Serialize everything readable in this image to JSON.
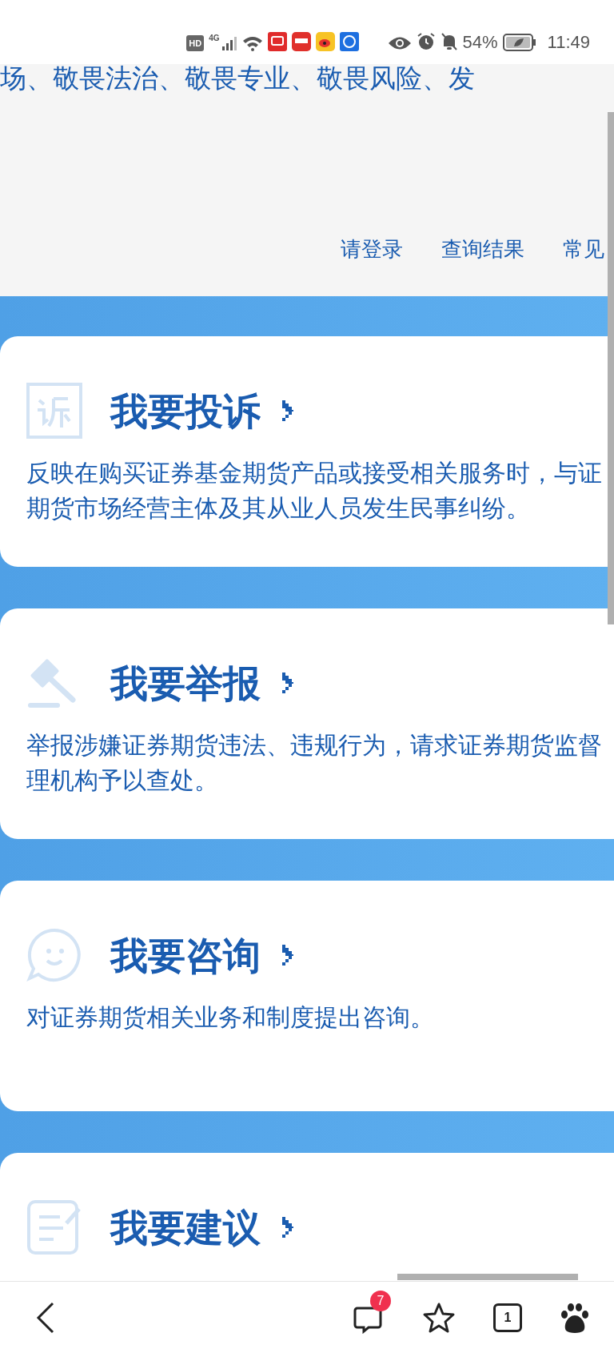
{
  "status_bar": {
    "hd": "HD",
    "network": "4G",
    "battery": "54%",
    "time": "11:49"
  },
  "banner_text": "场、敬畏法治、敬畏专业、敬畏风险、发",
  "nav_links": [
    "请登录",
    "查询结果",
    "常见"
  ],
  "cards": [
    {
      "kind": "complaint",
      "title": "我要投诉",
      "lines": [
        "反映在购买证券基金期货产品或接受相关服务时，与证",
        "期货市场经营主体及其从业人员发生民事纠纷。"
      ]
    },
    {
      "kind": "report",
      "title": "我要举报",
      "lines": [
        "举报涉嫌证券期货违法、违规行为，请求证券期货监督",
        "理机构予以查处。"
      ]
    },
    {
      "kind": "consult",
      "title": "我要咨询",
      "lines": [
        "对证券期货相关业务和制度提出咨询。"
      ]
    },
    {
      "kind": "suggest",
      "title": "我要建议"
    }
  ],
  "bottom_nav": {
    "badge": "7",
    "tabs_count": "1"
  }
}
